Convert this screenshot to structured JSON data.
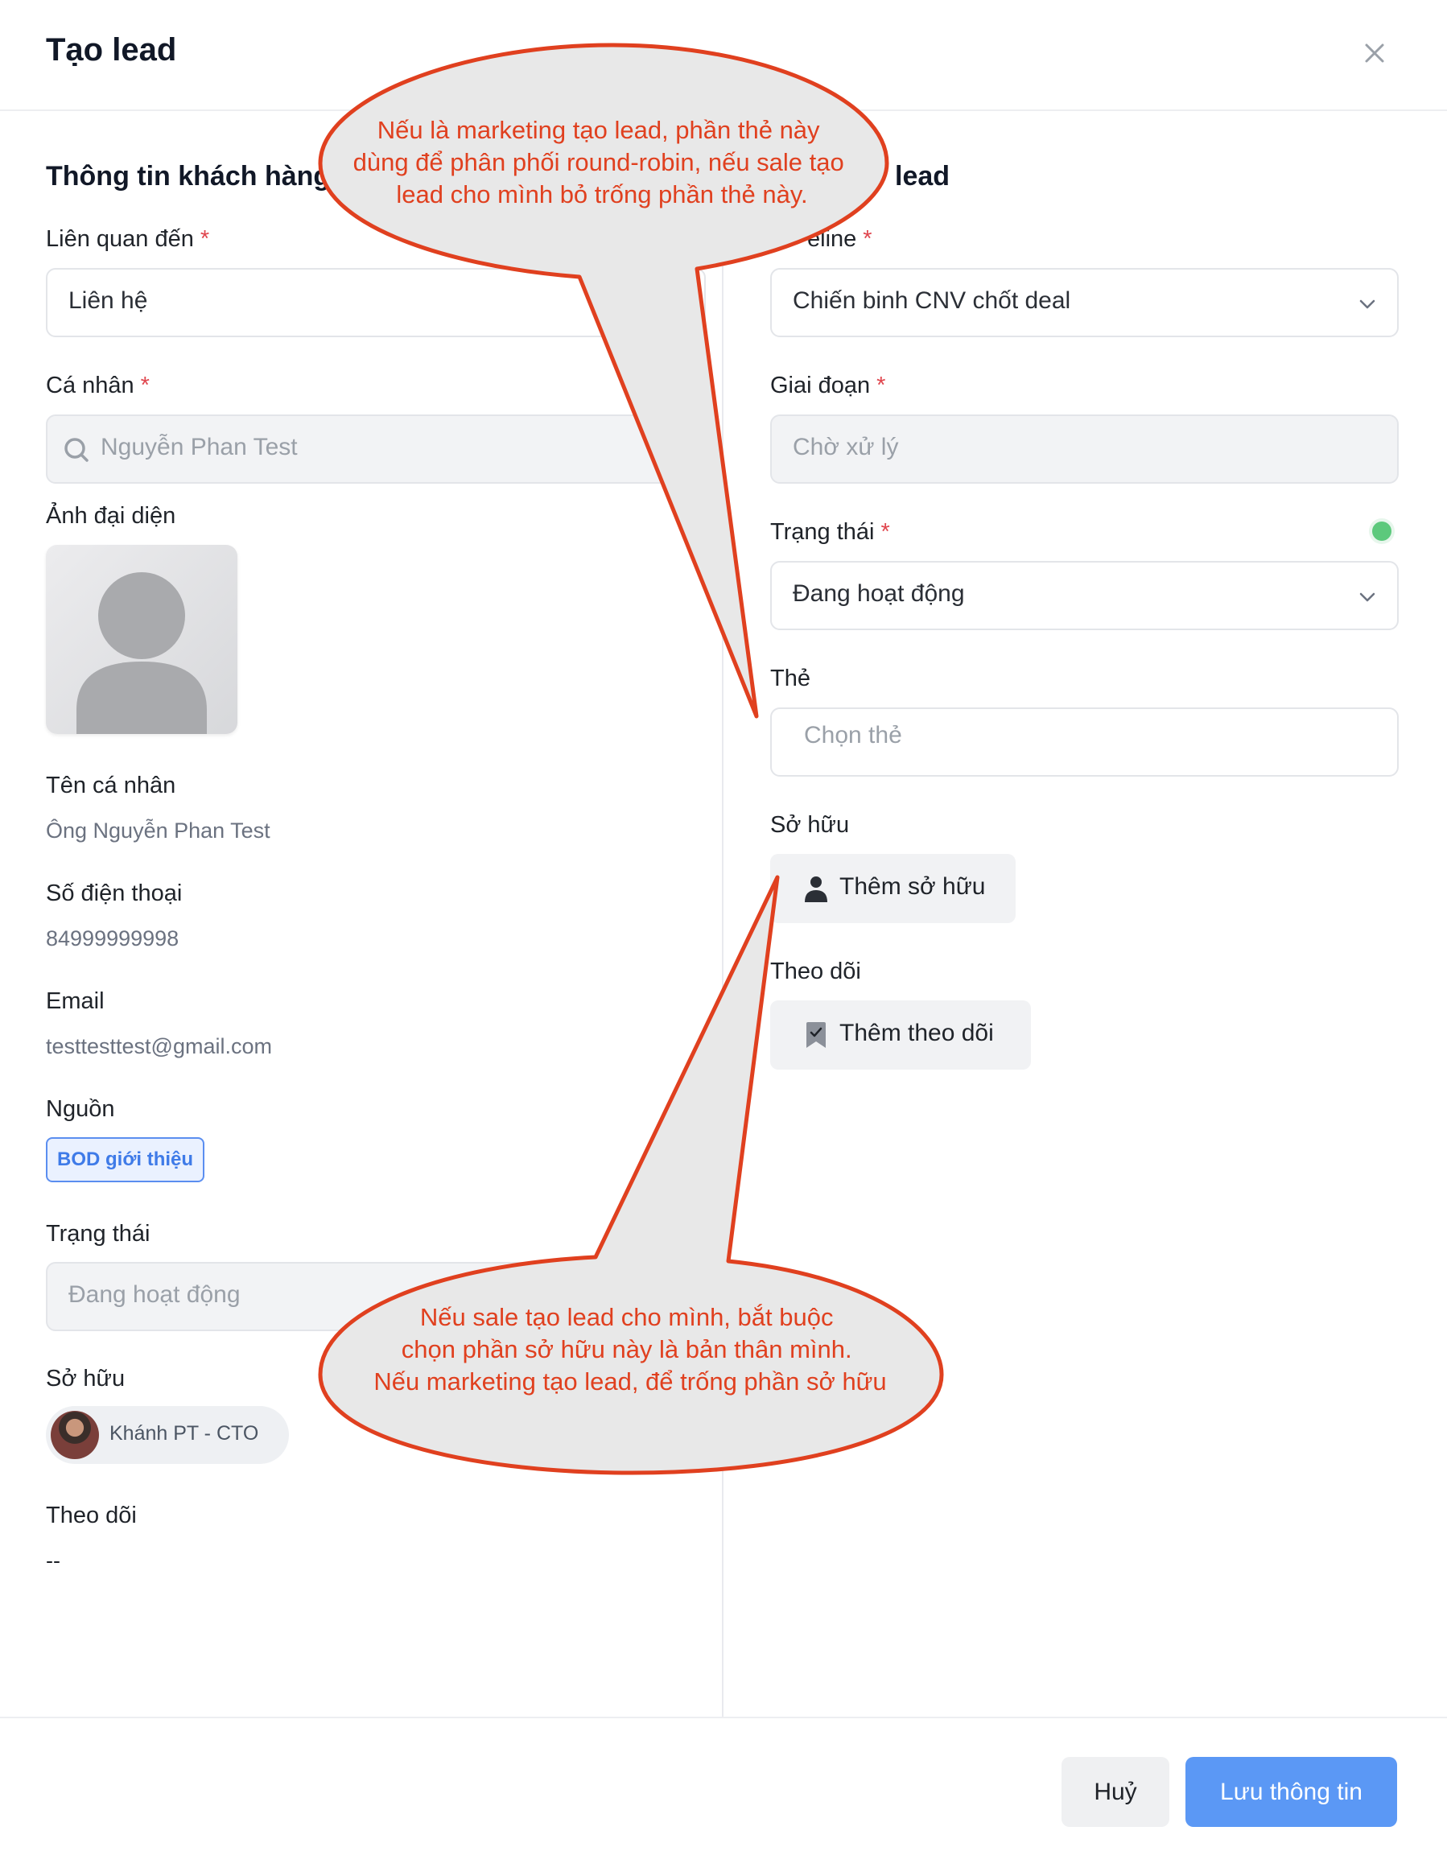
{
  "modal": {
    "title": "Tạo lead"
  },
  "left": {
    "section_title": "Thông tin khách hàng",
    "related_label": "Liên quan đến",
    "related_value": "Liên hệ",
    "person_label": "Cá nhân",
    "person_value": "Nguyễn Phan Test",
    "avatar_label": "Ảnh đại diện",
    "name_label": "Tên cá nhân",
    "name_value": "Ông Nguyễn Phan Test",
    "phone_label": "Số điện thoại",
    "phone_value": "84999999998",
    "email_label": "Email",
    "email_value": "testtesttest@gmail.com",
    "source_label": "Nguồn",
    "source_value": "BOD giới thiệu",
    "status_label": "Trạng thái",
    "status_value": "Đang hoạt động",
    "owner_label": "Sở hữu",
    "owner_name": "Khánh PT - CTO",
    "follow_label": "Theo dõi",
    "follow_value": "--"
  },
  "right": {
    "section_title_visible": "lead",
    "pipeline_label_visible": "eline",
    "pipeline_value": "Chiến binh CNV chốt deal",
    "stage_label": "Giai đoạn",
    "stage_value": "Chờ xử lý",
    "status_label": "Trạng thái",
    "status_value": "Đang hoạt động",
    "tag_label": "Thẻ",
    "tag_placeholder": "Chọn thẻ",
    "owner_label": "Sở hữu",
    "add_owner_label": "Thêm sở hữu",
    "follow_label": "Theo dõi",
    "add_follower_label": "Thêm theo dõi"
  },
  "footer": {
    "cancel_label": "Huỷ",
    "save_label": "Lưu thông tin"
  },
  "annotations": {
    "top_lines": [
      "Nếu là marketing tạo lead, phần thẻ này",
      "dùng để phân phối round-robin, nếu sale tạo",
      "lead cho mình bỏ trống phần thẻ này."
    ],
    "bottom_lines": [
      "Nếu sale tạo lead cho mình, bắt buộc",
      "chọn phần sở hữu này là bản thân mình.",
      "Nếu marketing tạo lead, để trống phần sở hữu"
    ]
  },
  "colors": {
    "primary": "#5b98f5",
    "required_star": "#e0464e",
    "status_active": "#5cc97c",
    "annotation_stroke": "#e0401f",
    "annotation_fill": "#e8e8e8",
    "annotation_text": "#e0401f"
  },
  "icons": {
    "close": "close-icon",
    "search": "search-icon",
    "chevron": "chevron-down-icon",
    "person": "person-icon",
    "bookmark": "bookmark-check-icon",
    "avatar_placeholder": "avatar-placeholder-icon"
  }
}
